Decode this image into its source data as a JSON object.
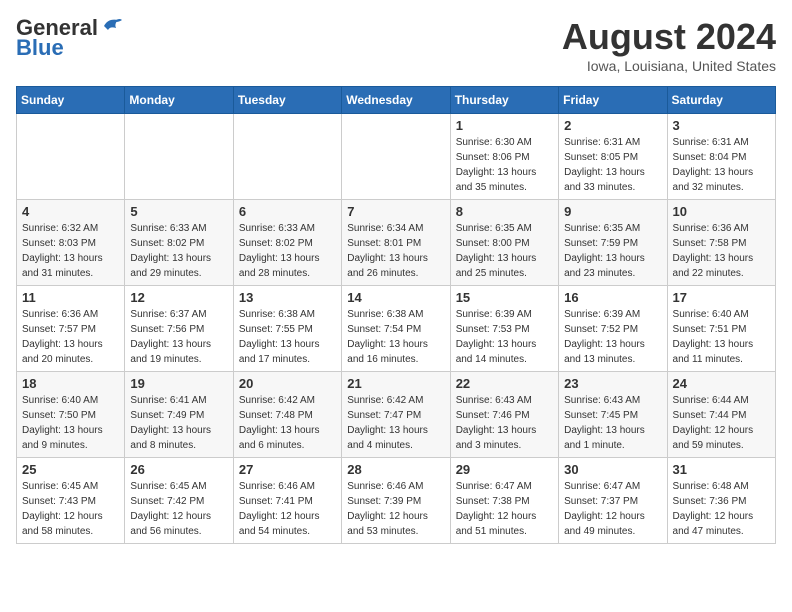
{
  "header": {
    "logo_general": "General",
    "logo_blue": "Blue",
    "title": "August 2024",
    "subtitle": "Iowa, Louisiana, United States"
  },
  "days_of_week": [
    "Sunday",
    "Monday",
    "Tuesday",
    "Wednesday",
    "Thursday",
    "Friday",
    "Saturday"
  ],
  "weeks": [
    [
      {
        "day": "",
        "info": ""
      },
      {
        "day": "",
        "info": ""
      },
      {
        "day": "",
        "info": ""
      },
      {
        "day": "",
        "info": ""
      },
      {
        "day": "1",
        "info": "Sunrise: 6:30 AM\nSunset: 8:06 PM\nDaylight: 13 hours\nand 35 minutes."
      },
      {
        "day": "2",
        "info": "Sunrise: 6:31 AM\nSunset: 8:05 PM\nDaylight: 13 hours\nand 33 minutes."
      },
      {
        "day": "3",
        "info": "Sunrise: 6:31 AM\nSunset: 8:04 PM\nDaylight: 13 hours\nand 32 minutes."
      }
    ],
    [
      {
        "day": "4",
        "info": "Sunrise: 6:32 AM\nSunset: 8:03 PM\nDaylight: 13 hours\nand 31 minutes."
      },
      {
        "day": "5",
        "info": "Sunrise: 6:33 AM\nSunset: 8:02 PM\nDaylight: 13 hours\nand 29 minutes."
      },
      {
        "day": "6",
        "info": "Sunrise: 6:33 AM\nSunset: 8:02 PM\nDaylight: 13 hours\nand 28 minutes."
      },
      {
        "day": "7",
        "info": "Sunrise: 6:34 AM\nSunset: 8:01 PM\nDaylight: 13 hours\nand 26 minutes."
      },
      {
        "day": "8",
        "info": "Sunrise: 6:35 AM\nSunset: 8:00 PM\nDaylight: 13 hours\nand 25 minutes."
      },
      {
        "day": "9",
        "info": "Sunrise: 6:35 AM\nSunset: 7:59 PM\nDaylight: 13 hours\nand 23 minutes."
      },
      {
        "day": "10",
        "info": "Sunrise: 6:36 AM\nSunset: 7:58 PM\nDaylight: 13 hours\nand 22 minutes."
      }
    ],
    [
      {
        "day": "11",
        "info": "Sunrise: 6:36 AM\nSunset: 7:57 PM\nDaylight: 13 hours\nand 20 minutes."
      },
      {
        "day": "12",
        "info": "Sunrise: 6:37 AM\nSunset: 7:56 PM\nDaylight: 13 hours\nand 19 minutes."
      },
      {
        "day": "13",
        "info": "Sunrise: 6:38 AM\nSunset: 7:55 PM\nDaylight: 13 hours\nand 17 minutes."
      },
      {
        "day": "14",
        "info": "Sunrise: 6:38 AM\nSunset: 7:54 PM\nDaylight: 13 hours\nand 16 minutes."
      },
      {
        "day": "15",
        "info": "Sunrise: 6:39 AM\nSunset: 7:53 PM\nDaylight: 13 hours\nand 14 minutes."
      },
      {
        "day": "16",
        "info": "Sunrise: 6:39 AM\nSunset: 7:52 PM\nDaylight: 13 hours\nand 13 minutes."
      },
      {
        "day": "17",
        "info": "Sunrise: 6:40 AM\nSunset: 7:51 PM\nDaylight: 13 hours\nand 11 minutes."
      }
    ],
    [
      {
        "day": "18",
        "info": "Sunrise: 6:40 AM\nSunset: 7:50 PM\nDaylight: 13 hours\nand 9 minutes."
      },
      {
        "day": "19",
        "info": "Sunrise: 6:41 AM\nSunset: 7:49 PM\nDaylight: 13 hours\nand 8 minutes."
      },
      {
        "day": "20",
        "info": "Sunrise: 6:42 AM\nSunset: 7:48 PM\nDaylight: 13 hours\nand 6 minutes."
      },
      {
        "day": "21",
        "info": "Sunrise: 6:42 AM\nSunset: 7:47 PM\nDaylight: 13 hours\nand 4 minutes."
      },
      {
        "day": "22",
        "info": "Sunrise: 6:43 AM\nSunset: 7:46 PM\nDaylight: 13 hours\nand 3 minutes."
      },
      {
        "day": "23",
        "info": "Sunrise: 6:43 AM\nSunset: 7:45 PM\nDaylight: 13 hours\nand 1 minute."
      },
      {
        "day": "24",
        "info": "Sunrise: 6:44 AM\nSunset: 7:44 PM\nDaylight: 12 hours\nand 59 minutes."
      }
    ],
    [
      {
        "day": "25",
        "info": "Sunrise: 6:45 AM\nSunset: 7:43 PM\nDaylight: 12 hours\nand 58 minutes."
      },
      {
        "day": "26",
        "info": "Sunrise: 6:45 AM\nSunset: 7:42 PM\nDaylight: 12 hours\nand 56 minutes."
      },
      {
        "day": "27",
        "info": "Sunrise: 6:46 AM\nSunset: 7:41 PM\nDaylight: 12 hours\nand 54 minutes."
      },
      {
        "day": "28",
        "info": "Sunrise: 6:46 AM\nSunset: 7:39 PM\nDaylight: 12 hours\nand 53 minutes."
      },
      {
        "day": "29",
        "info": "Sunrise: 6:47 AM\nSunset: 7:38 PM\nDaylight: 12 hours\nand 51 minutes."
      },
      {
        "day": "30",
        "info": "Sunrise: 6:47 AM\nSunset: 7:37 PM\nDaylight: 12 hours\nand 49 minutes."
      },
      {
        "day": "31",
        "info": "Sunrise: 6:48 AM\nSunset: 7:36 PM\nDaylight: 12 hours\nand 47 minutes."
      }
    ]
  ]
}
